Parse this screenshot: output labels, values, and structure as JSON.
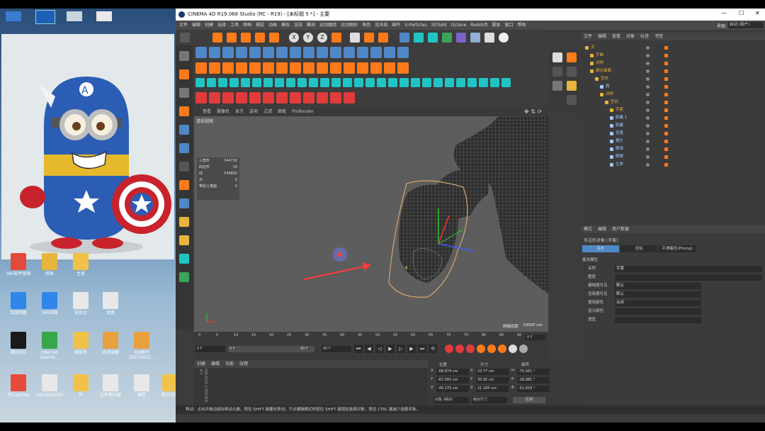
{
  "desktop": {
    "icons": [
      {
        "label": "360软件管家",
        "color": "#e24a3b"
      },
      {
        "label": "回收",
        "color": "#e8b43c"
      },
      {
        "label": "主目",
        "color": "#f0c24a"
      },
      {
        "label": "百度网盘",
        "color": "#2f86e8"
      },
      {
        "label": "360压缩",
        "color": "#2f86e8"
      },
      {
        "label": "知识点",
        "color": "#e8e8e8"
      },
      {
        "label": "优惠",
        "color": "#e8e8e8"
      },
      {
        "label": "腾讯QQ",
        "color": "#1a1a1a"
      },
      {
        "label": "Internet Downlo...",
        "color": "#3aa64b"
      },
      {
        "label": "项目单",
        "color": "#f0c24a"
      },
      {
        "label": "活动海报",
        "color": "#e8a040"
      },
      {
        "label": "QQ图片20210412...",
        "color": "#e8a040"
      },
      {
        "label": "FSCapture",
        "color": "#e84a3b"
      },
      {
        "label": "1911902020",
        "color": "#e8e8e8"
      },
      {
        "label": "外",
        "color": "#f0c24a"
      },
      {
        "label": "文件夹内容",
        "color": "#e8e8e8"
      },
      {
        "label": "储存",
        "color": "#e8e8e8"
      },
      {
        "label": "数字与学",
        "color": "#f0c24a"
      }
    ]
  },
  "window": {
    "title": "CINEMA 4D R19.068 Studio (RC - R19) - [未标题 5 *] - 主要",
    "controls": {
      "minimize": "—",
      "maximize": "☐",
      "close": "✕"
    }
  },
  "menubar": {
    "items": [
      "文件",
      "编辑",
      "创建",
      "选择",
      "工具",
      "网格",
      "捕捉",
      "动画",
      "模拟",
      "渲染",
      "雕刻",
      "运动跟踪",
      "运动图形",
      "角色",
      "流水线",
      "插件",
      "X-Particles",
      "3DToAll",
      "Octane",
      "Redshift",
      "脚本",
      "窗口",
      "帮助"
    ],
    "layout_label": "界面:",
    "layout_value": "启动 (用户)"
  },
  "viewport": {
    "menu": [
      "查看",
      "摄像机",
      "显示",
      "选项",
      "过滤",
      "面板",
      "ProRender"
    ],
    "camera_label": "透视视图",
    "hud": [
      {
        "label": "三角形",
        "value": "744730"
      },
      {
        "label": "四边形",
        "value": "14"
      },
      {
        "label": "线",
        "value": "744805"
      },
      {
        "label": "点",
        "value": "0"
      },
      {
        "label": "带状三角面",
        "value": "0"
      }
    ],
    "grid_spacing_label": "网格间距",
    "grid_spacing_value": "10000 cm"
  },
  "timeline": {
    "ticks": [
      "0",
      "5",
      "10",
      "15",
      "20",
      "25",
      "30",
      "35",
      "40",
      "45",
      "50",
      "55",
      "60",
      "65",
      "70",
      "75",
      "80",
      "85",
      "90"
    ],
    "frame_end_marker": "0 F",
    "current_frame": "0 F",
    "start_field": "0 F",
    "end_field": "90 F",
    "max_field": "90 F"
  },
  "objmgr": {
    "tabs": [
      "文件",
      "编辑",
      "查看",
      "对象",
      "标签",
      "书签"
    ],
    "rows": [
      {
        "name": "天",
        "indent": 0,
        "color": "#e8b43c"
      },
      {
        "name": "手曲",
        "indent": 1,
        "color": "#e8b43c"
      },
      {
        "name": "对称",
        "indent": 1,
        "color": "#e8b43c"
      },
      {
        "name": "细分曲面",
        "indent": 1,
        "color": "#e8b43c"
      },
      {
        "name": "空白",
        "indent": 2,
        "color": "#e8b43c"
      },
      {
        "name": "肩",
        "indent": 3,
        "color": "#9fc7ff"
      },
      {
        "name": "对称",
        "indent": 3,
        "color": "#e8b43c"
      },
      {
        "name": "空白",
        "indent": 4,
        "color": "#e8b43c"
      },
      {
        "name": "手套",
        "indent": 5,
        "color": "#e8b43c"
      },
      {
        "name": "胶囊.1",
        "indent": 5,
        "color": "#9fc7ff"
      },
      {
        "name": "胶囊",
        "indent": 5,
        "color": "#9fc7ff"
      },
      {
        "name": "克隆",
        "indent": 5,
        "color": "#9fc7ff"
      },
      {
        "name": "横片",
        "indent": 5,
        "color": "#9fc7ff"
      },
      {
        "name": "眼球",
        "indent": 5,
        "color": "#9fc7ff"
      },
      {
        "name": "眼睛",
        "indent": 5,
        "color": "#9fc7ff"
      },
      {
        "name": "主体",
        "indent": 5,
        "color": "#9fc7ff"
      }
    ]
  },
  "attrmgr": {
    "tabs": [
      "模式",
      "编辑",
      "用户数据"
    ],
    "object_title": "多边形对象 [手套]",
    "subtabs": [
      "基本",
      "坐标",
      "平滑着色(Phong)"
    ],
    "section": "基本属性",
    "fields": [
      {
        "label": "名称",
        "value": "手套"
      },
      {
        "label": "图层",
        "value": ""
      },
      {
        "label": "编辑器可见",
        "value": "默认"
      },
      {
        "label": "渲染器可见",
        "value": "默认"
      },
      {
        "label": "使用颜色",
        "value": "关闭"
      },
      {
        "label": "显示颜色",
        "value": ""
      },
      {
        "label": "透显",
        "value": ""
      }
    ]
  },
  "matmgr": {
    "tabs": [
      "创建",
      "编辑",
      "功能",
      "纹理"
    ]
  },
  "coords": {
    "headers": [
      "位置",
      "尺寸",
      "旋转"
    ],
    "rows": [
      {
        "axis": "X",
        "pos": "-68.874 cm",
        "size": "23.77 cm",
        "rlabel": "H",
        "rot": "-75.561 °"
      },
      {
        "axis": "Y",
        "pos": "-67.005 cm",
        "size": "35.95 cm",
        "rlabel": "P",
        "rot": "-18.981 °"
      },
      {
        "axis": "Z",
        "pos": "-40.175 cm",
        "size": "21.185 cm",
        "rlabel": "B",
        "rot": "-51.633 °"
      }
    ],
    "mode_select": "对象 (相对)",
    "size_select": "绝对尺寸",
    "apply_label": "应用"
  },
  "status": "移动：点击并拖动鼠标移动元素。按住 SHIFT 键量化移动；节点编辑模式时按住 SHIFT 键增加选择对象；按住 CTRL 键减少选择对象。",
  "colors": {
    "accent": "#4f88c6",
    "orange": "#ff7a1a",
    "cyan": "#21c4c4"
  }
}
